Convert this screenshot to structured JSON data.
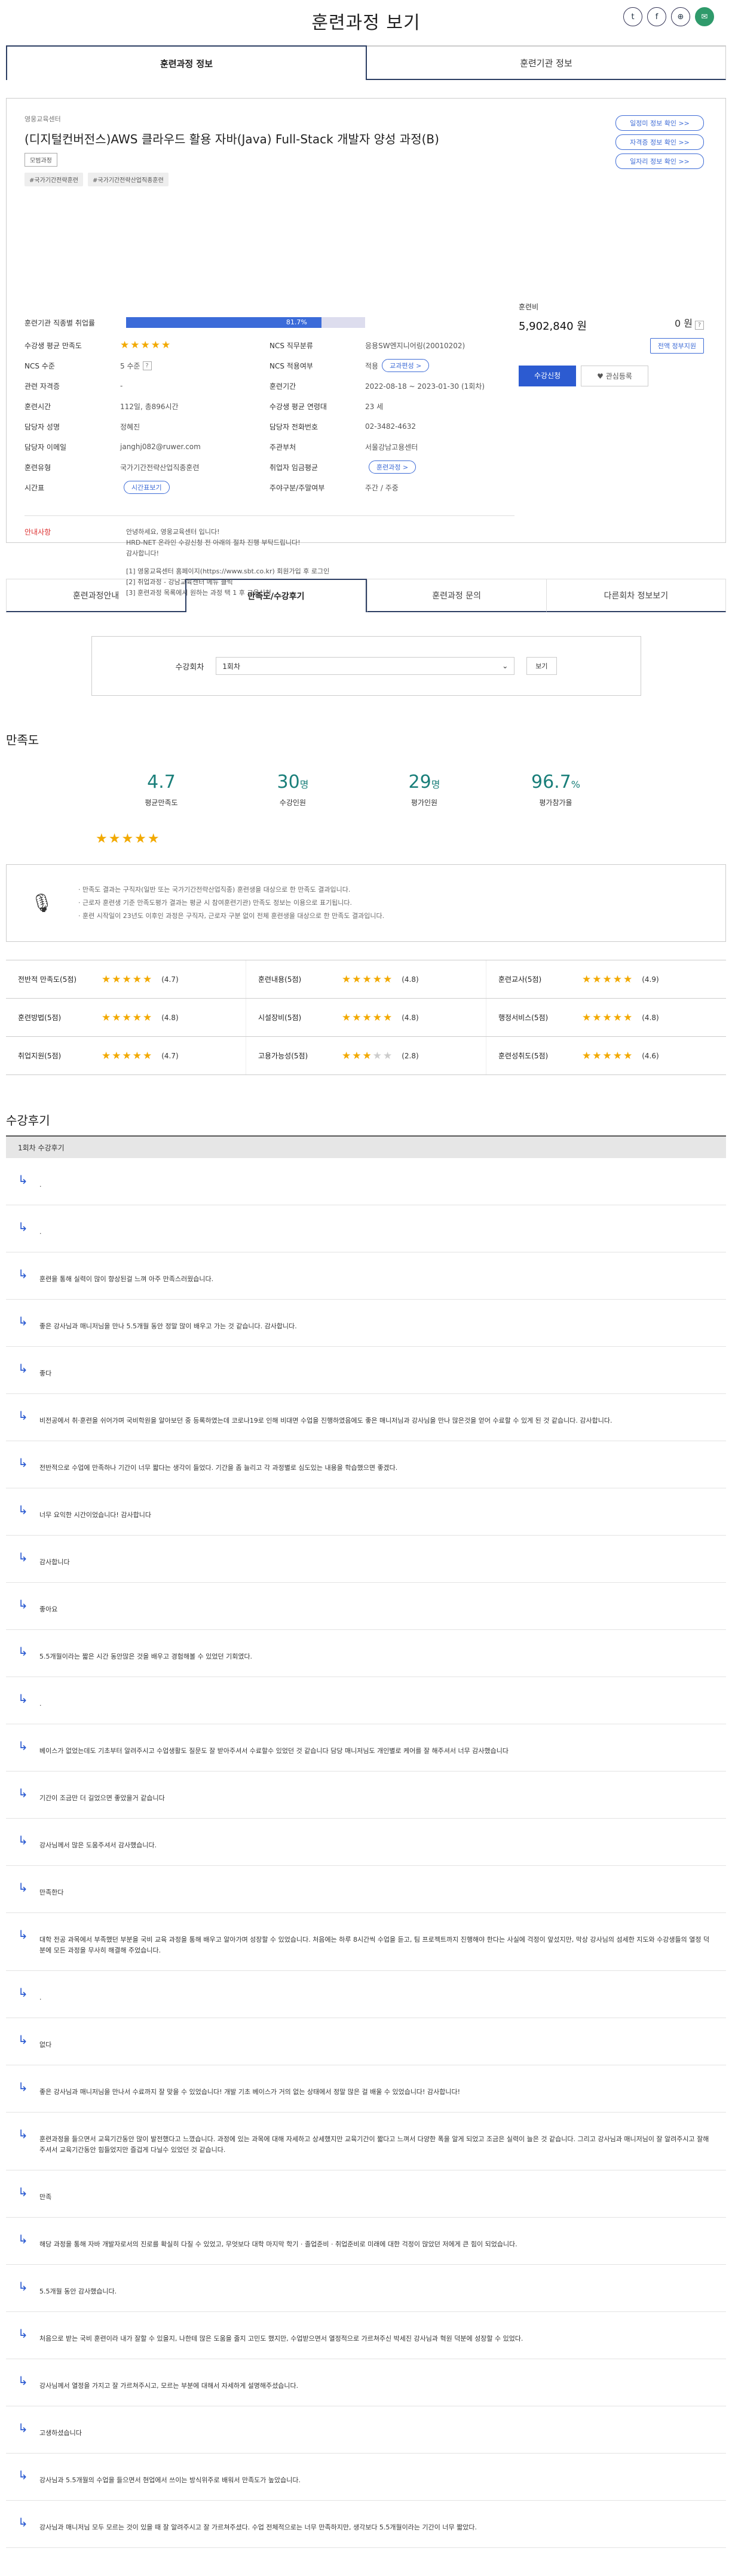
{
  "page": {
    "title": "훈련과정 보기"
  },
  "top_tabs": [
    "훈련과정 정보",
    "훈련기관 정보"
  ],
  "course": {
    "org": "영웅교육센터",
    "title": "(디지털컨버전스)AWS 클라우드 활용 자바(Java) Full-Stack 개발자 양성 과정(B)",
    "badge": "모범과정",
    "tags": [
      "#국가기간전략훈련",
      "#국가기간전략산업직종훈련"
    ],
    "side_buttons": [
      "일정미 정보 확인 >>",
      "자격증 정보 확인 >>",
      "일자리 정보 확인 >>"
    ],
    "employment_rate_label": "훈련기관 직종별 취업률",
    "employment_rate_text": "81.7%",
    "employment_rate": 0.817,
    "info_left": [
      {
        "label": "수강생 평균 만족도",
        "value": ""
      },
      {
        "label": "NCS 수준",
        "value": "5 수준"
      },
      {
        "label": "관련 자격증",
        "value": "-"
      },
      {
        "label": "훈련시간",
        "value": "112일, 총896시간"
      },
      {
        "label": "담당자 성명",
        "value": "정혜진"
      },
      {
        "label": "담당자 이메일",
        "value": "janghj082@ruwer.com"
      },
      {
        "label": "훈련유형",
        "value": "국가기간전략산업직종훈련"
      },
      {
        "label": "시간표",
        "value": ""
      }
    ],
    "info_right": [
      {
        "label": "NCS 직무분류",
        "value": "응용SW엔지니어링(20010202)"
      },
      {
        "label": "NCS 적용여부",
        "value": "적용"
      },
      {
        "label": "훈련기간",
        "value": "2022-08-18 ~ 2023-01-30 (1회차)"
      },
      {
        "label": "수강생 평균 연령대",
        "value": "23 세"
      },
      {
        "label": "담당자 전화번호",
        "value": "02-3482-4632"
      },
      {
        "label": "주관부처",
        "value": "서울강남고용센터"
      },
      {
        "label": "취업자 임금평균",
        "value": "훈련과정 >"
      },
      {
        "label": "주야구분/주말여부",
        "value": "주간 / 주중"
      }
    ],
    "ncs_pill": "교과편성 >",
    "timetable_button": "시간표보기",
    "notice_label": "안내사항",
    "notice_lines": [
      "안녕하세요, 영웅교육센터 입니다!",
      "HRD-NET 온라인 수강신청 전 아래의 절차 진행 부탁드립니다!",
      "감사합니다!",
      "",
      "[1] 영웅교육센터 홈페이지(https://www.sbt.co.kr) 회원가입 후 로그인",
      "[2] 취업과정 - 강남교육센터 메뉴 클릭",
      "[3] 훈련과정 목록에서 원하는 과정 택 1 후 교육신청"
    ],
    "price_label": "훈련비",
    "price": "5,902,840 원",
    "self_price": "0 원",
    "self_price_button": "전액 정부지원",
    "apply_button": "수강신청",
    "fav_button": "♥ 관심등록"
  },
  "sub_tabs": [
    "훈련과정안내",
    "만족도/수강후기",
    "훈련과정 문의",
    "다른회차 정보보기"
  ],
  "round": {
    "label": "수강회차",
    "selected": "1회차",
    "button": "보기"
  },
  "satisfaction": {
    "title": "만족도",
    "stats": [
      {
        "num": "4.7",
        "unit": "",
        "caption": "평균만족도"
      },
      {
        "num": "30",
        "unit": "명",
        "caption": "수강인원"
      },
      {
        "num": "29",
        "unit": "명",
        "caption": "평가인원"
      },
      {
        "num": "96.7",
        "unit": "%",
        "caption": "평가참가율"
      }
    ],
    "notes": [
      "· 만족도 결과는 구직자(일반 또는 국가기간전략산업직종) 훈련생을 대상으로 한 만족도 결과입니다.",
      "· 근로자 훈련생 기준 만족도평가 결과는 평균 시 참여훈련기관) 만족도 정보는 이용으로 표기됩니다.",
      "· 훈련 시작일이 23년도 이후인 과정은 구직자, 근로자 구분 없이 전체 훈련생을 대상으로 한 만족도 결과입니다."
    ],
    "scores": [
      [
        {
          "label": "전반적 만족도(5점)",
          "value": "(4.7)",
          "stars": 5
        },
        {
          "label": "훈련내용(5점)",
          "value": "(4.8)",
          "stars": 5
        },
        {
          "label": "훈련교사(5점)",
          "value": "(4.9)",
          "stars": 5
        }
      ],
      [
        {
          "label": "훈련방법(5점)",
          "value": "(4.8)",
          "stars": 5
        },
        {
          "label": "시설장비(5점)",
          "value": "(4.8)",
          "stars": 5
        },
        {
          "label": "행정서비스(5점)",
          "value": "(4.8)",
          "stars": 5
        }
      ],
      [
        {
          "label": "취업지원(5점)",
          "value": "(4.7)",
          "stars": 5
        },
        {
          "label": "고용가능성(5점)",
          "value": "(2.8)",
          "stars": 3
        },
        {
          "label": "훈련성취도(5점)",
          "value": "(4.6)",
          "stars": 5
        }
      ]
    ]
  },
  "reviews": {
    "title": "수강후기",
    "round_label": "1회차 수강후기",
    "items": [
      ".",
      ".",
      "훈련을 통해 실력이 많이 향상된걸 느껴 아주 만족스러웠습니다.",
      "좋은 강사님과 매니저님을 만나 5.5개월 동안 정말 많이 배우고 가는 것 같습니다. 감사합니다.",
      "좋다",
      "비전공에서 취·훈련을 쉬어가며 국비학원을 알아보던 중 등록하였는데 코로나19로 인해 비대면 수업을 진행하였음에도 좋은 매니저님과 강사님을 만나 많은것을 얻어 수료할 수 있게 된 것 같습니다. 감사합니다.",
      "전반적으로 수업에 만족하나 기간이 너무 짧다는 생각이 들었다. 기간을 좀 늘리고 각 과정별로 심도있는 내용을 학습했으면 좋겠다.",
      "너무 요익한 시간이었습니다! 감사합니다",
      "감사합니다",
      "좋아요",
      "5.5개월이라는 짧은 시간 동안많은 것을 배우고 경험해볼 수 있었던 기회였다.",
      ".",
      "베이스가 없었는데도 기초부터 알려주시고 수업생활도 질문도 잘 받아주셔서 수료할수 있었던 것 같습니다 담당 매니저님도 개인별로 케어를 잘 해주셔서 너무 감사했습니다",
      "기간이 조금만 더 길었으면 좋았을거 같습니다",
      "강사님께서 많은 도움주셔서 감사했습니다.",
      "만족한다",
      "대학 전공 과목에서 부족했던 부분을 국비 교육 과정을 통해 배우고 알아가며 성장할 수 있었습니다. 처음에는 하루 8시간씩 수업을 듣고, 팀 프로젝트까지 진행해야 한다는 사실에 걱정이 앞섰지만, 막상 강사님의 섬세한 지도와 수강생들의 열정 덕분에 모든 과정을 무사히 해결해 주었습니다.",
      ".",
      "없다",
      "좋은 강사님과 매니저님을 만나서 수료까지 잘 맞을 수 있었습니다! 개발 기초 베이스가 거의 없는 상태에서 정말 많은 걸 배울 수 있었습니다! 감사합니다!",
      "훈련과정을 들으면서 교육기간동안 많이 발전했다고 느꼈습니다. 과정에 있는 과목에 대해 자세하고 상세했지만 교육기간이 짧다고 느껴서 다양한 폭을 알게 되었고 조금은 실력이 늘은 것 같습니다. 그리고 강사님과 매니저님이 잘 알려주시고 잘해주셔서 교육기간동안 힘들었지만 즐겁게 다닐수 있었던 것 같습니다.",
      "만족",
      "해당 과정을 통해 자바 개발자로서의 진로를 확실히 다질 수 있었고, 무엇보다 대학 마지막 학기 · 졸업준비 · 취업준비로 미래에 대한 걱정이 많았던 저에게 큰 힘이 되었습니다.",
      "5.5개월 동안 감사했습니다.",
      "처음으로 받는 국비 훈련이라 내가 잘할 수 있을지, 나한테 많은 도움을 줄지 고민도 했지만, 수업받으면서 열정적으로 가르쳐주신 박세진 강사님과 혁원 덕분에 성장할 수 있었다.",
      "강사님께서 열정을 가지고 잘 가르쳐주시고, 모르는 부분에 대해서 자세하게 설명해주셨습니다.",
      "고생하셨습니다",
      "강사님과 5.5개월의 수업을 들으면서 현업에서 쓰이는 방식위주로 배워서 만족도가 높았습니다.",
      "강사님과 매니저님 모두 모르는 것이 있을 때 잘 알려주시고 잘 가르쳐주셨다. 수업 전체적으로는 너무 만족하지만, 생각보다 5.5개월이라는 기간이 너무 짧았다."
    ]
  },
  "colors": {
    "accent": "#2c5bd1",
    "teal": "#1a7f7a",
    "star": "#f2a900",
    "notice": "#d33333"
  }
}
